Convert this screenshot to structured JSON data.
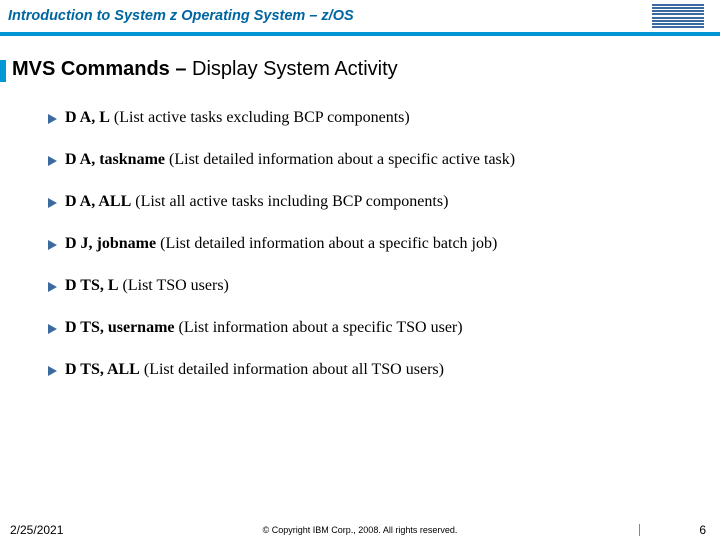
{
  "header": {
    "title": "Introduction to System z Operating System – z/OS"
  },
  "title": {
    "bold": "MVS Commands – ",
    "normal": "Display System Activity"
  },
  "bullets": [
    {
      "cmd": "D  A, L",
      "desc": "   (List active tasks excluding BCP components)"
    },
    {
      "cmd": "D  A, taskname",
      "desc": "  (List detailed information about a specific active task)"
    },
    {
      "cmd": "D  A, ALL",
      "desc": "  (List all active tasks including BCP components)"
    },
    {
      "cmd": "D  J, jobname",
      "desc": "  (List detailed information about a specific batch job)"
    },
    {
      "cmd": "D  TS, L",
      "desc": "  (List TSO users)"
    },
    {
      "cmd": "D  TS, username",
      "desc": "  (List information about a specific TSO user)"
    },
    {
      "cmd": "D  TS, ALL",
      "desc": "  (List detailed information about all TSO users)"
    }
  ],
  "footer": {
    "date": "2/25/2021",
    "copyright": "© Copyright IBM Corp., 2008. All rights reserved.",
    "page": "6"
  }
}
